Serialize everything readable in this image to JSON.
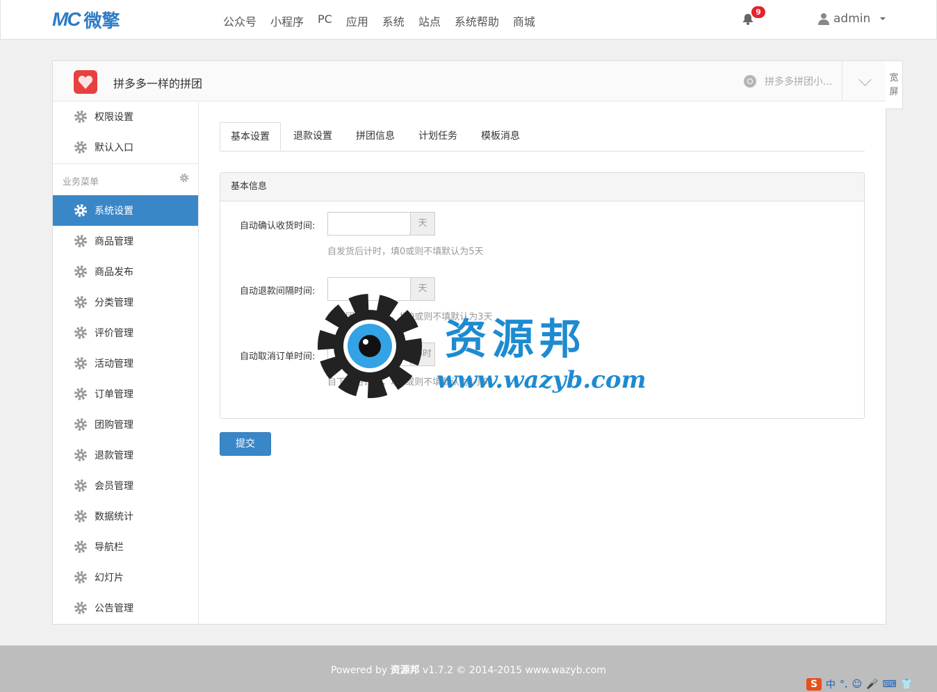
{
  "header": {
    "logo_mark": "MC",
    "logo_text": "微擎",
    "nav": [
      "公众号",
      "小程序",
      "PC",
      "应用",
      "系统",
      "站点",
      "系统帮助",
      "商城"
    ],
    "notification_count": "9",
    "username": "admin"
  },
  "app": {
    "title": "拼多多一样的拼团",
    "mini_program_label": "拼多多拼团小...",
    "wide_screen_label": "宽屏"
  },
  "sidebar": {
    "top_items": [
      "权限设置",
      "默认入口"
    ],
    "section_title": "业务菜单",
    "items": [
      "系统设置",
      "商品管理",
      "商品发布",
      "分类管理",
      "评价管理",
      "活动管理",
      "订单管理",
      "团购管理",
      "退款管理",
      "会员管理",
      "数据统计",
      "导航栏",
      "幻灯片",
      "公告管理"
    ],
    "active_index": 0
  },
  "tabs": [
    "基本设置",
    "退款设置",
    "拼团信息",
    "计划任务",
    "模板消息"
  ],
  "panel": {
    "title": "基本信息",
    "fields": [
      {
        "label": "自动确认收货时间:",
        "addon": "天",
        "help": "自发货后计时，填0或则不填默认为5天",
        "value": ""
      },
      {
        "label": "自动退款间隔时间:",
        "addon": "天",
        "help": "自拼团开始计时，填0或则不填默认为3天",
        "value": ""
      },
      {
        "label": "自动取消订单时间:",
        "addon": "小时",
        "help": "自下单后计时，填0或则不填默认为1小时",
        "value": ""
      }
    ]
  },
  "submit_label": "提交",
  "watermark": {
    "text": "资源邦",
    "url": "www.wazyb.com"
  },
  "footer": {
    "prefix": "Powered by",
    "brand": "资源邦",
    "suffix": "v1.7.2 © 2014-2015 www.wazyb.com"
  },
  "ime": {
    "label": "中"
  },
  "colors": {
    "primary": "#3a87c8",
    "badge": "#e6202c",
    "logo": "#2e7cc4"
  }
}
